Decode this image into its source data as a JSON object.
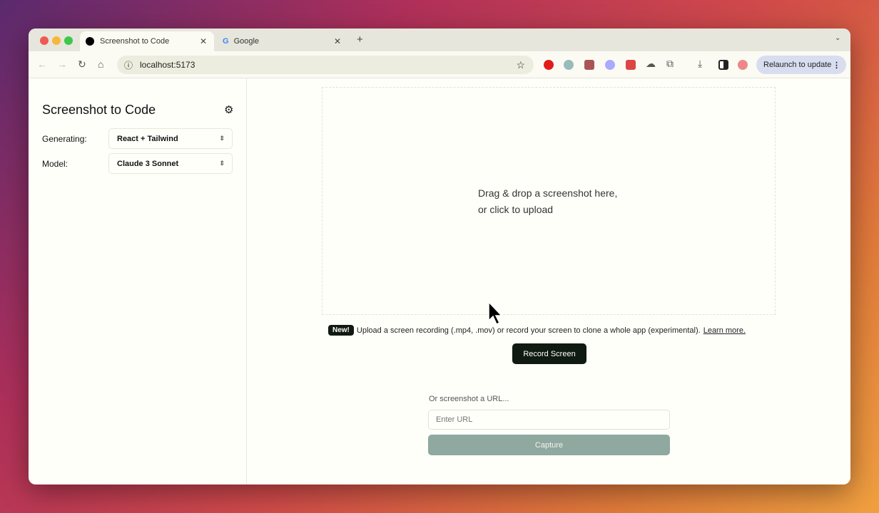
{
  "browser": {
    "tabs": [
      {
        "label": "Screenshot to Code",
        "active": true
      },
      {
        "label": "Google",
        "active": false
      }
    ],
    "new_tab": "+",
    "url": "localhost:5173",
    "relaunch_label": "Relaunch to update"
  },
  "sidebar": {
    "title": "Screenshot to Code",
    "generating_label": "Generating:",
    "generating_value": "React + Tailwind",
    "model_label": "Model:",
    "model_value": "Claude 3 Sonnet"
  },
  "main": {
    "drop_line1": "Drag & drop a screenshot here,",
    "drop_line2": "or click to upload",
    "new_badge": "New!",
    "notice": "Upload a screen recording (.mp4, .mov) or record your screen to clone a whole app (experimental).",
    "learn_more": "Learn more.",
    "record_button": "Record Screen",
    "url_label": "Or screenshot a URL...",
    "url_placeholder": "Enter URL",
    "capture_button": "Capture"
  }
}
